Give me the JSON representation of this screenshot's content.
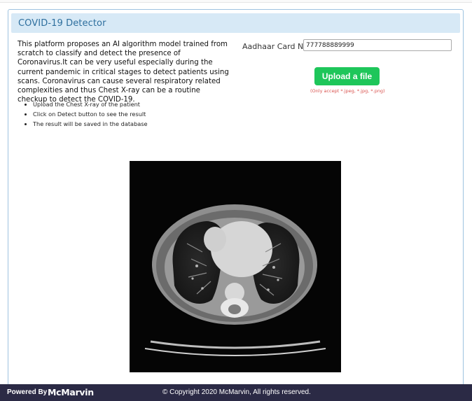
{
  "panel": {
    "title": "COVID-19 Detector"
  },
  "description": "This platform proposes an AI algorithm model trained from scratch to classify and detect the presence of Coronavirus.It can be very useful especially during the current pandemic in critical stages to detect patients using scans. Coronavirus can cause several respiratory related complexities and thus Chest X-ray can be a routine checkup to detect the COVID-19.",
  "steps": [
    "Upload the Chest X-ray of the patient",
    "Click on Detect button to see the result",
    "The result will be saved in the database"
  ],
  "form": {
    "aadhaar_label": "Aadhaar Card No.:",
    "aadhaar_value": "777788889999",
    "upload_label": "Upload a file",
    "accept_note": "(Only accept *.jpeg, *.jpg, *.png)"
  },
  "image": {
    "kind": "chest-ct-scan"
  },
  "footer": {
    "powered_by": "Powered By",
    "brand": "McMarvin",
    "copyright": "© Copyright 2020 McMarvin, All rights reserved."
  },
  "colors": {
    "panel_border": "#9ec3e0",
    "heading_bg": "#d7e9f6",
    "title": "#2e6f9e",
    "upload_button": "#1ec65a",
    "accept_note": "#d9534f",
    "footer_bg": "#2b2a45"
  }
}
